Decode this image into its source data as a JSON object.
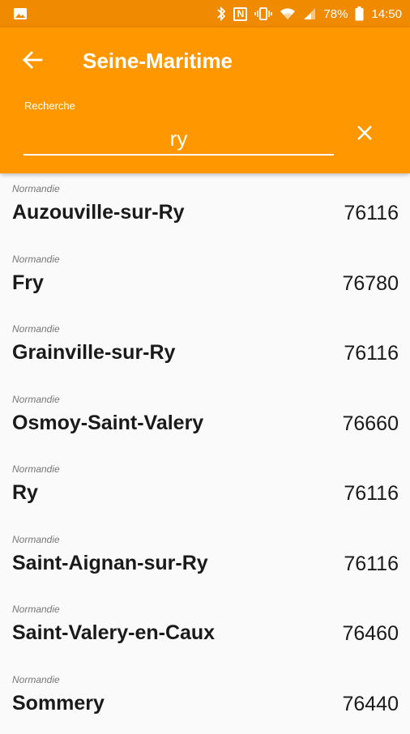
{
  "status_bar": {
    "battery": "78%",
    "time": "14:50",
    "nfc": "N",
    "icons": [
      "image-icon",
      "bluetooth-icon",
      "nfc-icon",
      "vibrate-icon",
      "wifi-icon",
      "signal-icon",
      "battery-icon"
    ]
  },
  "header": {
    "title": "Seine-Maritime",
    "search_label": "Recherche",
    "search_value": "ry"
  },
  "results": [
    {
      "region": "Normandie",
      "city": "Auzouville-sur-Ry",
      "code": "76116"
    },
    {
      "region": "Normandie",
      "city": "Fry",
      "code": "76780"
    },
    {
      "region": "Normandie",
      "city": "Grainville-sur-Ry",
      "code": "76116"
    },
    {
      "region": "Normandie",
      "city": "Osmoy-Saint-Valery",
      "code": "76660"
    },
    {
      "region": "Normandie",
      "city": "Ry",
      "code": "76116"
    },
    {
      "region": "Normandie",
      "city": "Saint-Aignan-sur-Ry",
      "code": "76116"
    },
    {
      "region": "Normandie",
      "city": "Saint-Valery-en-Caux",
      "code": "76460"
    },
    {
      "region": "Normandie",
      "city": "Sommery",
      "code": "76440"
    }
  ],
  "colors": {
    "status_bar": "#f08a00",
    "app_bar": "#ff9800",
    "list_bg": "#fafafa"
  }
}
